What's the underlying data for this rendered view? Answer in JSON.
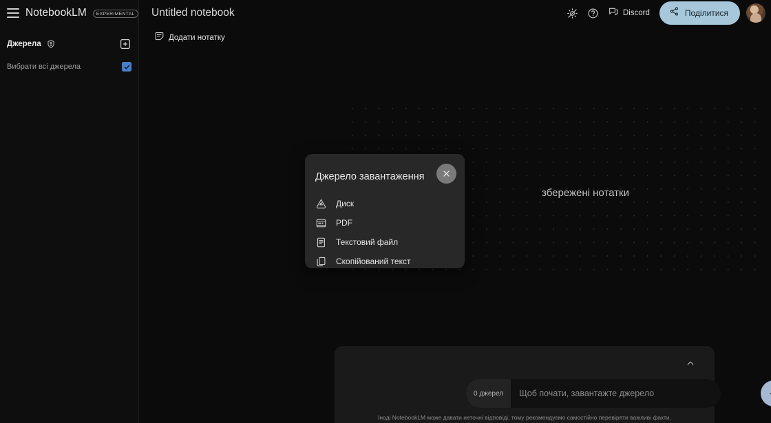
{
  "app": {
    "brand": "NotebookLM",
    "badge": "EXPERIMENTAL",
    "menu_icon": "hamburger-icon"
  },
  "sidebar": {
    "sources_title": "Джерела",
    "shield_icon": "shield-icon",
    "add_source_icon": "add-box-icon",
    "select_all_label": "Вибрати всі джерела",
    "select_all_checked": true,
    "checkbox_color": "#4a7fc4"
  },
  "topbar": {
    "notebook_title": "Untitled notebook",
    "brightness_icon": "brightness-icon",
    "help_icon": "help-circle-icon",
    "discord_label": "Discord",
    "discord_icon": "discord-chat-icon",
    "share_label": "Поділитися",
    "share_icon": "share-icon",
    "share_bg": "#a7c7da",
    "avatar": "user-avatar"
  },
  "main": {
    "add_note_label": "Додати нотатку",
    "add_note_icon": "note-add-icon",
    "saved_notes_text": "збережені нотатки"
  },
  "modal": {
    "title": "Джерело завантаження",
    "close_icon": "close-icon",
    "items": [
      {
        "label": "Диск",
        "icon": "google-drive-icon"
      },
      {
        "label": "PDF",
        "icon": "pdf-file-icon"
      },
      {
        "label": "Текстовий файл",
        "icon": "text-file-icon"
      },
      {
        "label": "Скопійований текст",
        "icon": "copy-icon"
      }
    ]
  },
  "composer": {
    "source_count": "0 джерел",
    "placeholder": "Щоб почати, завантажте джерело",
    "value": "",
    "send_icon": "arrow-right-icon",
    "send_bg": "#a7b8d2",
    "collapse_icon": "chevron-up-icon",
    "disclaimer": "Іноді NotebookLM може давати неточні відповіді, тому рекомендуємо самостійно перевіряти важливі факти."
  }
}
